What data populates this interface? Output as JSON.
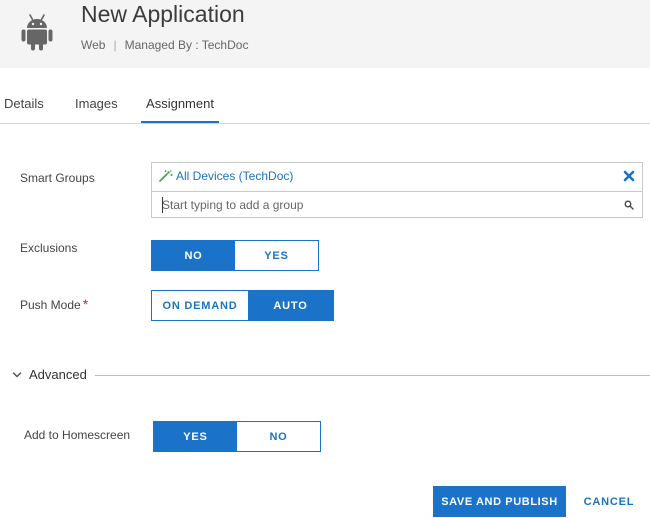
{
  "header": {
    "title": "New Application",
    "platform": "Web",
    "separator": "|",
    "managed_by": "Managed By : TechDoc",
    "icon": "android-icon"
  },
  "tabs": [
    {
      "label": "Details",
      "active": false
    },
    {
      "label": "Images",
      "active": false
    },
    {
      "label": "Assignment",
      "active": true
    }
  ],
  "form": {
    "smart_groups": {
      "label": "Smart Groups",
      "selected": [
        "All Devices (TechDoc)"
      ],
      "placeholder": "Start typing to add a group"
    },
    "exclusions": {
      "label": "Exclusions",
      "options": [
        "NO",
        "YES"
      ],
      "selected": "NO"
    },
    "push_mode": {
      "label": "Push Mode",
      "required_marker": "*",
      "options": [
        "ON DEMAND",
        "AUTO"
      ],
      "selected": "AUTO"
    },
    "advanced": {
      "label": "Advanced",
      "expanded": true
    },
    "add_to_homescreen": {
      "label": "Add to Homescreen",
      "options": [
        "YES",
        "NO"
      ],
      "selected": "YES"
    }
  },
  "footer": {
    "save_label": "SAVE AND PUBLISH",
    "cancel_label": "CANCEL"
  },
  "colors": {
    "accent": "#1a73c8",
    "required": "#d9262b",
    "header_bg": "#f4f4f4",
    "group_icon": "#3aa83a"
  }
}
